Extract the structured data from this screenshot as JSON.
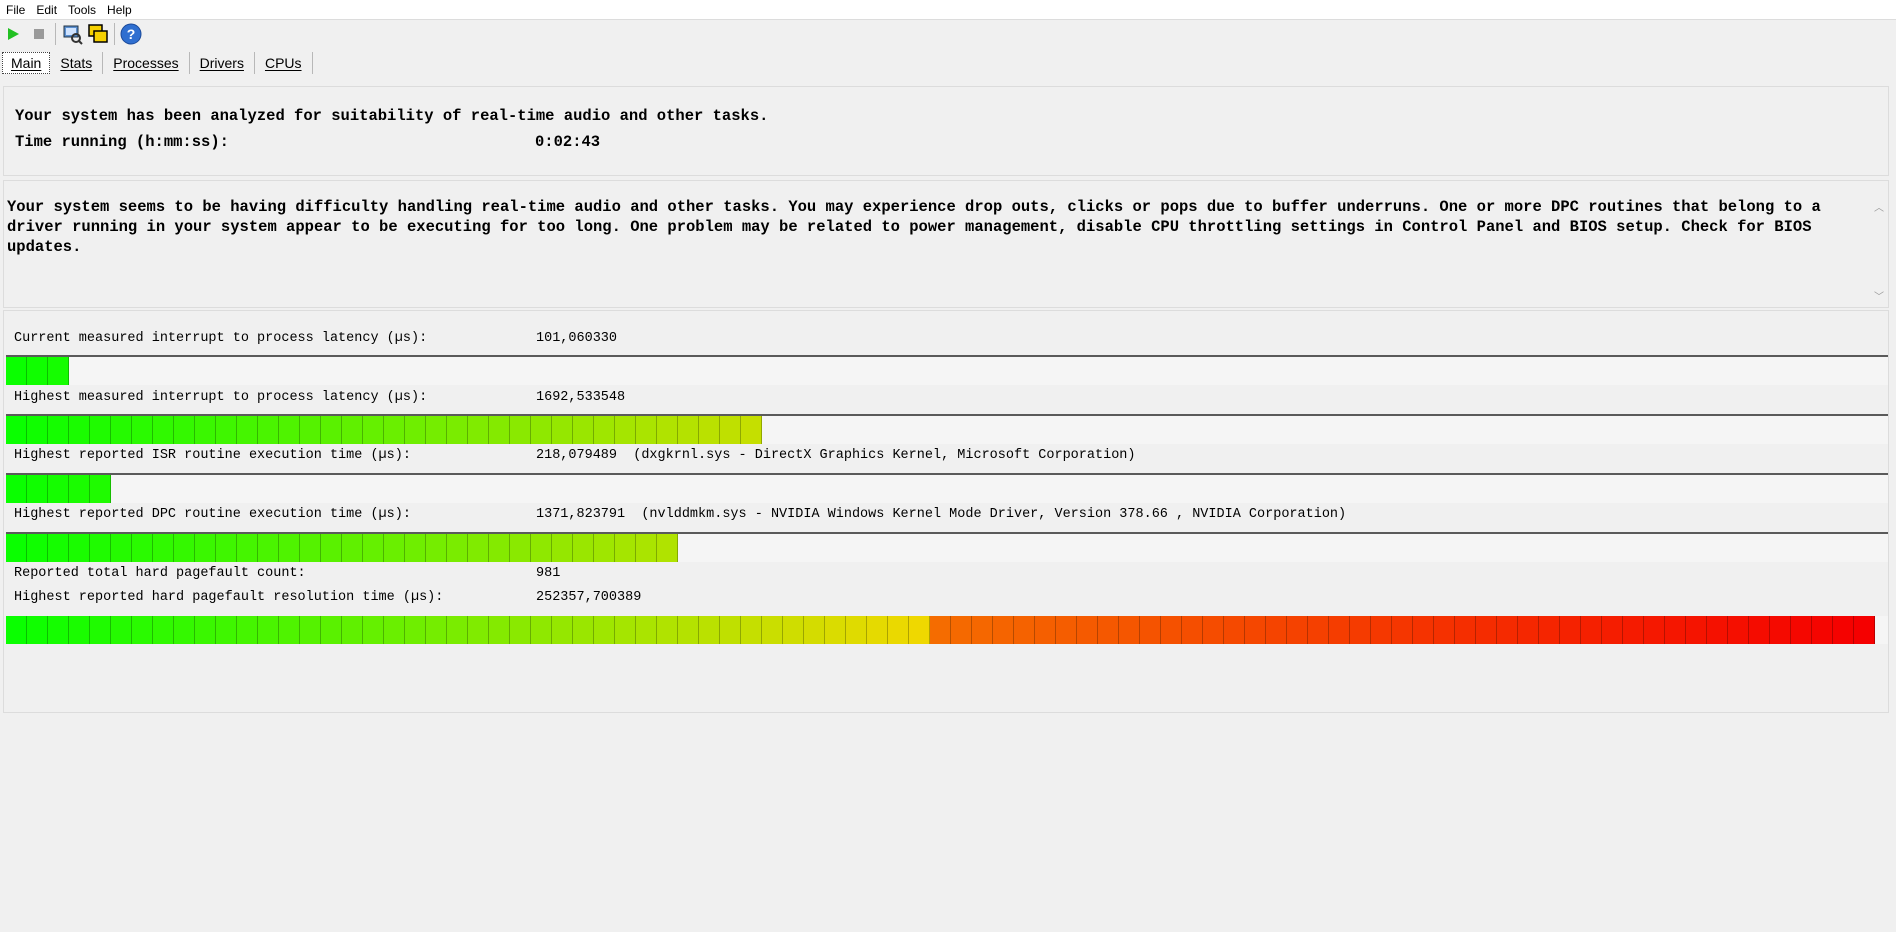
{
  "menu": [
    "File",
    "Edit",
    "Tools",
    "Help"
  ],
  "toolbar": [
    "play-icon",
    "stop-icon",
    "analyze-icon",
    "windows-icon",
    "help-icon"
  ],
  "tabs": [
    "Main",
    "Stats",
    "Processes",
    "Drivers",
    "CPUs"
  ],
  "summary": {
    "analyzed": "Your system has been analyzed for suitability of real-time audio and other tasks.",
    "time_label": "Time running (h:mm:ss):",
    "time_value": "0:02:43"
  },
  "description": "Your system seems to be having difficulty handling real-time audio and other tasks. You may experience drop outs, clicks or pops due to buffer underruns. One or more DPC routines that belong to a driver running in your system appear to be executing for too long. One problem may be related to power management, disable CPU throttling settings in Control Panel and BIOS setup. Check for BIOS updates.",
  "metrics": [
    {
      "label": "Current measured interrupt to process latency (µs):",
      "value": "101,060330",
      "level": 0.033
    },
    {
      "label": "Highest measured interrupt to process latency (µs):",
      "value": "1692,533548",
      "level": 0.4
    },
    {
      "label": "Highest reported ISR routine execution time (µs):",
      "value": "218,079489  (dxgkrnl.sys - DirectX Graphics Kernel, Microsoft Corporation)",
      "level": 0.058
    },
    {
      "label": "Highest reported DPC routine execution time (µs):",
      "value": "1371,823791  (nvlddmkm.sys - NVIDIA Windows Kernel Mode Driver, Version 378.66 , NVIDIA Corporation)",
      "level": 0.36
    }
  ],
  "pagefault": {
    "count_label": "Reported total hard pagefault count:",
    "count_value": "981",
    "time_label": "Highest reported hard pagefault resolution time (µs):",
    "time_value": "252357,700389",
    "level": 1.0
  }
}
